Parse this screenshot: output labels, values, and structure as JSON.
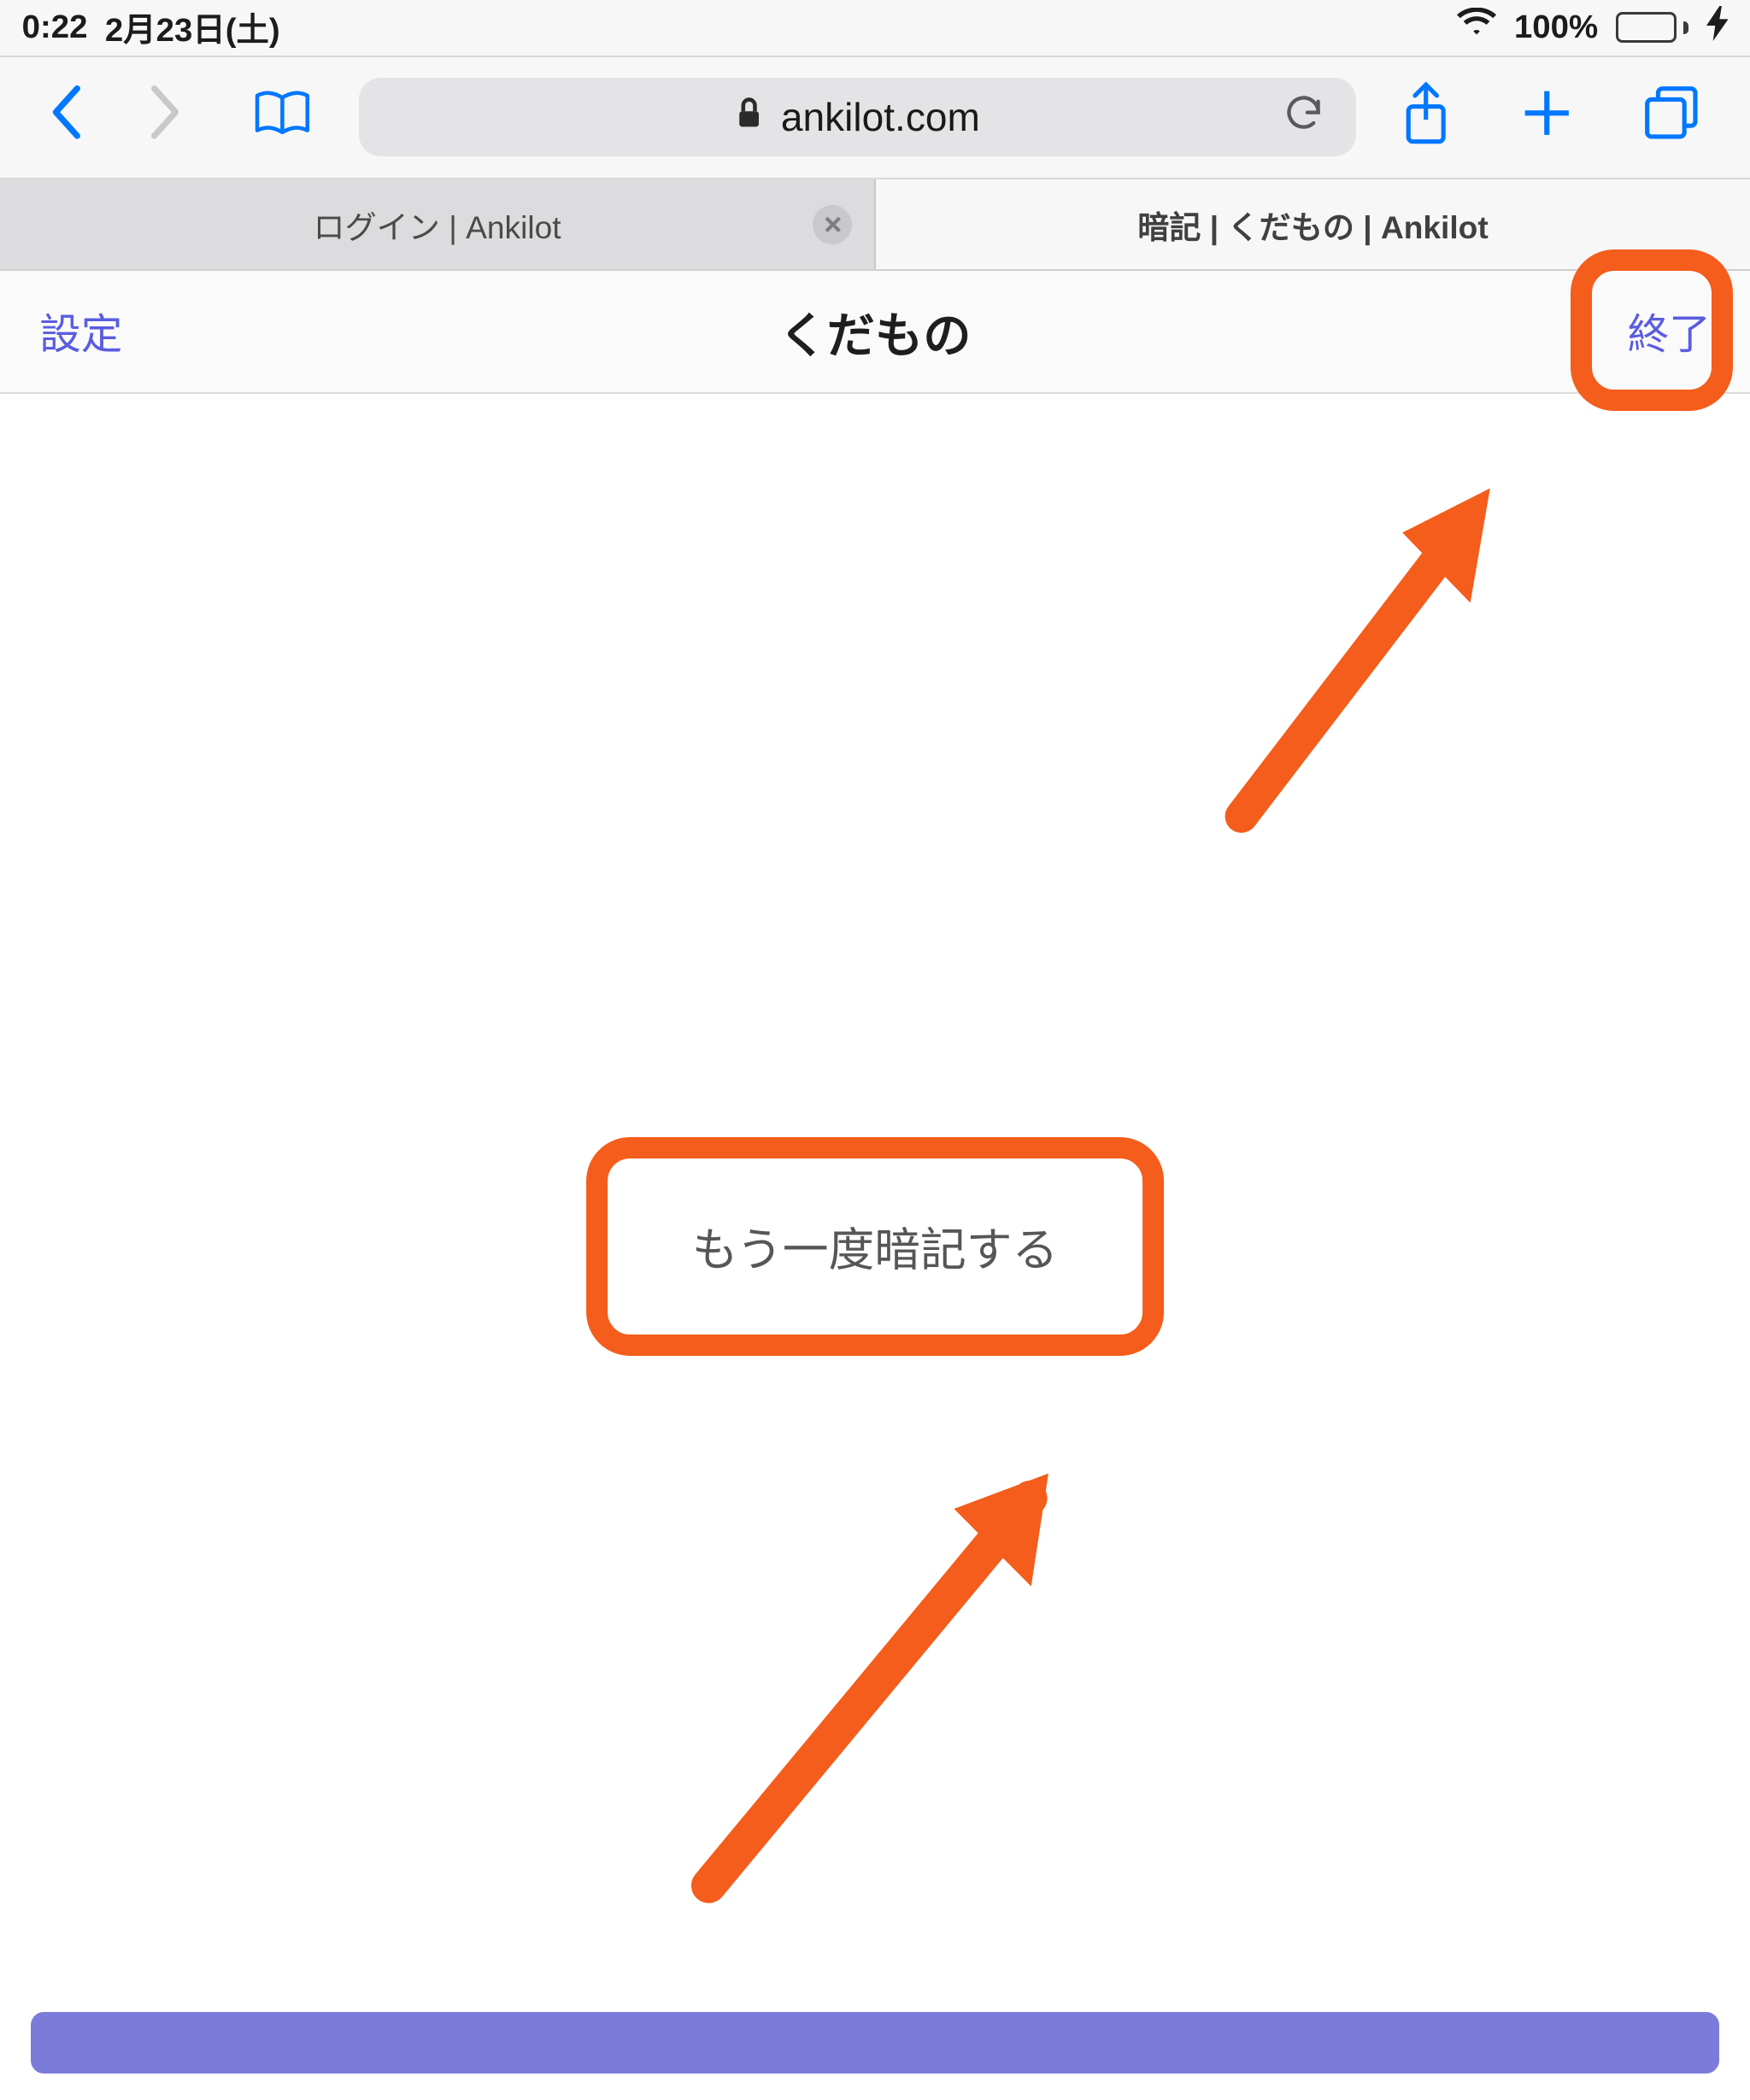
{
  "status": {
    "time": "0:22",
    "date": "2月23日(土)",
    "battery_pct": "100%"
  },
  "safari": {
    "domain": "ankilot.com",
    "tabs": [
      {
        "title": "ログイン | Ankilot",
        "active": false
      },
      {
        "title": "暗記 | くだもの | Ankilot",
        "active": true
      }
    ]
  },
  "page": {
    "settings_label": "設定",
    "title": "くだもの",
    "finish_label": "終了",
    "again_button": "もう一度暗記する"
  },
  "annotations": {
    "highlight_finish": true,
    "highlight_again_button": true,
    "arrows": [
      "to_finish",
      "to_again_button"
    ],
    "color": "#f45d1b"
  }
}
